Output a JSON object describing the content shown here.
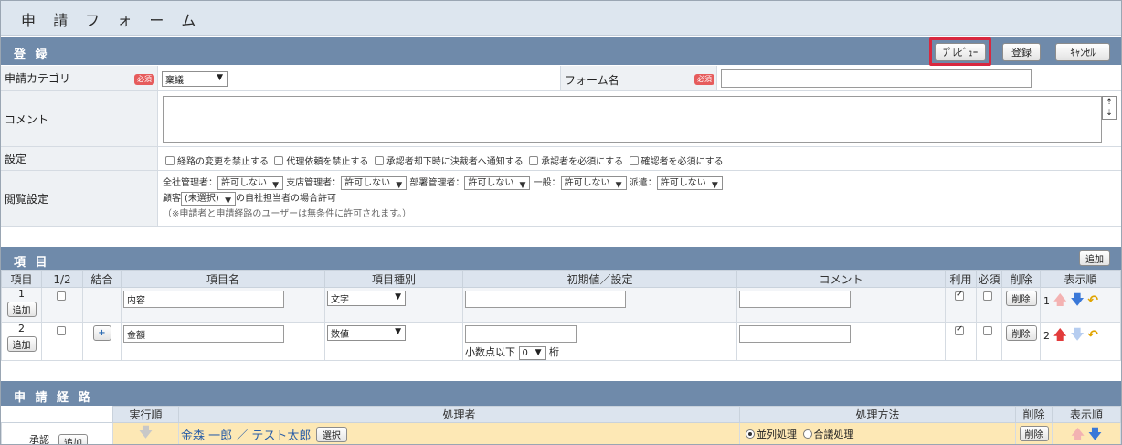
{
  "page": {
    "title": "申 請 フ ォ ー ム"
  },
  "registration": {
    "header": "登 録",
    "preview_button": "ﾌﾟﾚﾋﾞｭｰ",
    "register_button": "登録",
    "cancel_button": "ｷｬﾝｾﾙ",
    "required_badge": "必須",
    "category_label": "申請カテゴリ",
    "category_value": "稟議",
    "form_name_label": "フォーム名",
    "form_name_value": "",
    "comment_label": "コメント",
    "comment_value": "",
    "settings_label": "設定",
    "settings_options": [
      "経路の変更を禁止する",
      "代理依頼を禁止する",
      "承認者却下時に決裁者へ通知する",
      "承認者を必須にする",
      "確認者を必須にする"
    ],
    "view_label": "閲覧設定",
    "view_permissions": [
      {
        "label": "全社管理者：",
        "value": "許可しない"
      },
      {
        "label": "支店管理者：",
        "value": "許可しない"
      },
      {
        "label": "部署管理者：",
        "value": "許可しない"
      },
      {
        "label": "一般：",
        "value": "許可しない"
      },
      {
        "label": "派遣：",
        "value": "許可しない"
      }
    ],
    "customer_label": "顧客",
    "customer_value": "(未選択)",
    "customer_suffix": "の自社担当者の場合許可",
    "view_note": "（※申請者と申請経路のユーザーは無条件に許可されます。）"
  },
  "items": {
    "header": "項 目",
    "add_button": "追加",
    "columns": [
      "項目",
      "1/2",
      "結合",
      "項目名",
      "項目種別",
      "初期値／設定",
      "コメント",
      "利用",
      "必須",
      "削除",
      "表示順"
    ],
    "rows": [
      {
        "num": "1",
        "add": "追加",
        "name": "内容",
        "type": "文字",
        "default": "",
        "comment": "",
        "use": true,
        "required": false,
        "delete": "削除",
        "order": "1"
      },
      {
        "num": "2",
        "add": "追加",
        "join": "+",
        "name": "金額",
        "type": "数値",
        "default": "",
        "decimal_label": "小数点以下",
        "decimal_value": "0",
        "decimal_unit": "桁",
        "comment": "",
        "use": true,
        "required": false,
        "delete": "削除",
        "order": "2"
      }
    ]
  },
  "route": {
    "header": "申 請 経 路",
    "columns": [
      "実行順",
      "処理者",
      "処理方法",
      "削除",
      "表示順"
    ],
    "row": {
      "label": "承認",
      "add": "追加",
      "processor": "金森 一郎 ／ テスト太郎",
      "select_button": "選択",
      "method_parallel": "並列処理",
      "method_consult": "合議処理",
      "delete": "削除"
    }
  }
}
